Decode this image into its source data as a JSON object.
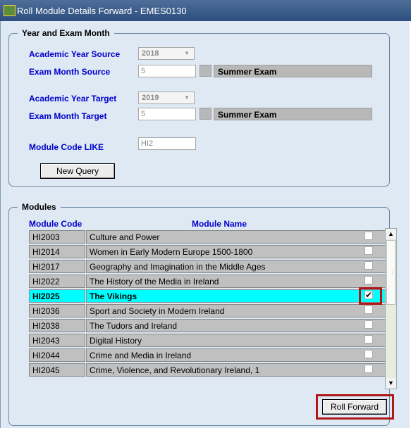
{
  "window": {
    "title": "Roll Module Details Forward - EMES0130"
  },
  "year_exam": {
    "legend": "Year and Exam Month",
    "ay_source_label": "Academic Year Source",
    "ay_source_value": "2018",
    "em_source_label": "Exam Month Source",
    "em_source_value": "5",
    "em_source_name": "Summer Exam",
    "ay_target_label": "Academic Year Target",
    "ay_target_value": "2019",
    "em_target_label": "Exam Month Target",
    "em_target_value": "5",
    "em_target_name": "Summer Exam",
    "module_like_label": "Module Code LIKE",
    "module_like_value": "HI2",
    "new_query_label": "New Query"
  },
  "modules": {
    "legend": "Modules",
    "col_code": "Module Code",
    "col_name": "Module Name",
    "rows": [
      {
        "code": "HI2003",
        "name": "Culture and Power",
        "checked": false
      },
      {
        "code": "HI2014",
        "name": "Women in Early Modern Europe 1500-1800",
        "checked": false
      },
      {
        "code": "HI2017",
        "name": "Geography  and Imagination in the Middle Ages",
        "checked": false
      },
      {
        "code": "HI2022",
        "name": "The History of the Media in Ireland",
        "checked": false
      },
      {
        "code": "HI2025",
        "name": "The Vikings",
        "checked": true,
        "selected": true
      },
      {
        "code": "HI2036",
        "name": "Sport and Society in Modern Ireland",
        "checked": false
      },
      {
        "code": "HI2038",
        "name": "The Tudors and Ireland",
        "checked": false
      },
      {
        "code": "HI2043",
        "name": "Digital History",
        "checked": false
      },
      {
        "code": "HI2044",
        "name": "Crime and Media in Ireland",
        "checked": false
      },
      {
        "code": "HI2045",
        "name": "Crime, Violence, and Revolutionary Ireland, 1",
        "checked": false
      }
    ],
    "roll_forward_label": "Roll Forward"
  },
  "icons": {
    "check_mark": "✔",
    "arrow_up": "▲",
    "arrow_down": "▼",
    "grip": "⋮"
  },
  "colors": {
    "selected_row": "#00ffff",
    "label_blue": "#0000cc",
    "highlight_red": "#b01818"
  }
}
